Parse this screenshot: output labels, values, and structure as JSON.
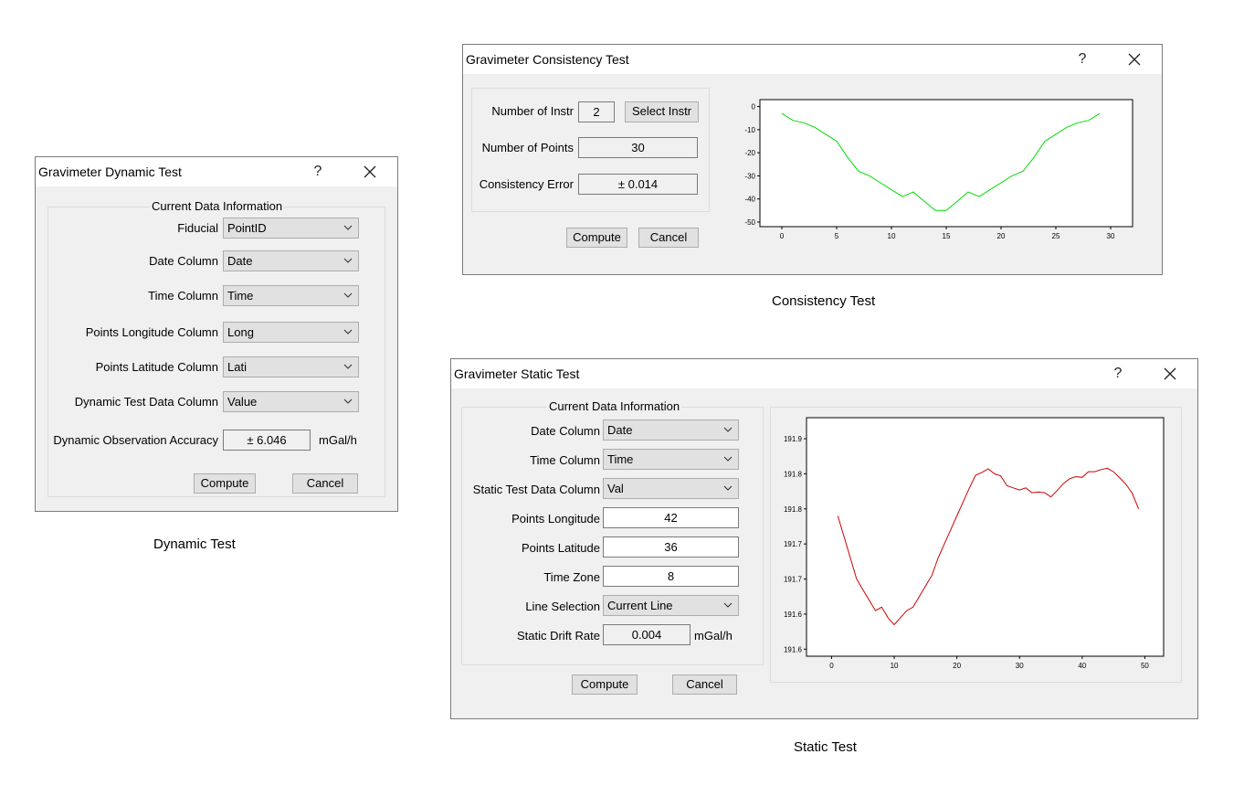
{
  "dynamic": {
    "title": "Gravimeter Dynamic Test",
    "help": "?",
    "group_title": "Current Data Information",
    "fields": [
      {
        "label": "Fiducial",
        "value": "PointID"
      },
      {
        "label": "Date Column",
        "value": "Date"
      },
      {
        "label": "Time Column",
        "value": "Time"
      },
      {
        "label": "Points Longitude Column",
        "value": "Long"
      },
      {
        "label": "Points Latitude Column",
        "value": "Lati"
      },
      {
        "label": "Dynamic Test Data Column",
        "value": "Value"
      }
    ],
    "accuracy_label": "Dynamic Observation Accuracy",
    "accuracy_value": "± 6.046",
    "accuracy_unit": "mGal/h",
    "compute": "Compute",
    "cancel": "Cancel",
    "caption": "Dynamic Test"
  },
  "consistency": {
    "title": "Gravimeter Consistency Test",
    "help": "?",
    "instr_label": "Number of Instr",
    "instr_value": "2",
    "select_instr": "Select Instr",
    "points_label": "Number of Points",
    "points_value": "30",
    "error_label": "Consistency Error",
    "error_value": "± 0.014",
    "compute": "Compute",
    "cancel": "Cancel",
    "caption": "Consistency Test"
  },
  "static": {
    "title": "Gravimeter Static Test",
    "help": "?",
    "group_title": "Current Data Information",
    "combos": [
      {
        "label": "Date Column",
        "value": "Date"
      },
      {
        "label": "Time Column",
        "value": "Time"
      },
      {
        "label": "Static Test Data Column",
        "value": "Val"
      }
    ],
    "inputs": [
      {
        "label": "Points Longitude",
        "value": "42"
      },
      {
        "label": "Points Latitude",
        "value": "36"
      },
      {
        "label": "Time Zone",
        "value": "8"
      }
    ],
    "line_label": "Line Selection",
    "line_value": "Current Line",
    "drift_label": "Static Drift Rate",
    "drift_value": "0.004",
    "drift_unit": "mGal/h",
    "compute": "Compute",
    "cancel": "Cancel",
    "caption": "Static Test"
  },
  "chart_data": [
    {
      "type": "line",
      "xlim": [
        -2,
        32
      ],
      "ylim": [
        -52,
        3
      ],
      "x_ticks": [
        "0",
        "5",
        "10",
        "15",
        "20",
        "25",
        "30"
      ],
      "y_ticks": [
        "0",
        "-10",
        "-20",
        "-30",
        "-40",
        "-50"
      ],
      "series": [
        {
          "color": "#00dd00",
          "x": [
            0,
            1,
            2,
            3,
            4,
            5,
            6,
            7,
            8,
            9,
            10,
            11,
            12,
            13,
            14,
            15,
            16,
            17,
            18,
            19,
            20,
            21,
            22,
            23,
            24,
            25,
            26,
            27,
            28,
            29
          ],
          "y": [
            -3,
            -6,
            -7,
            -9,
            -12,
            -15,
            -22,
            -28,
            -30,
            -33,
            -36,
            -39,
            -37,
            -41,
            -45,
            -45,
            -41,
            -37,
            -39,
            -36,
            -33,
            -30,
            -28,
            -22,
            -15,
            -12,
            -9,
            -7,
            -6,
            -3
          ]
        }
      ]
    },
    {
      "type": "line",
      "xlim": [
        -4,
        53
      ],
      "ylim": [
        191.59,
        191.93
      ],
      "x_ticks": [
        "0",
        "10",
        "20",
        "30",
        "40",
        "50"
      ],
      "y_ticks": [
        "191.9",
        "191.8",
        "191.8",
        "191.7",
        "191.7",
        "191.6",
        "191.6"
      ],
      "series": [
        {
          "color": "#cc0000",
          "x": [
            1,
            2,
            3,
            4,
            5,
            6,
            7,
            8,
            9,
            10,
            11,
            12,
            13,
            14,
            15,
            16,
            17,
            18,
            19,
            20,
            21,
            22,
            23,
            24,
            25,
            26,
            27,
            28,
            29,
            30,
            31,
            32,
            33,
            34,
            35,
            36,
            37,
            38,
            39,
            40,
            41,
            42,
            43,
            44,
            45,
            46,
            47,
            48,
            49
          ],
          "y": [
            191.79,
            191.76,
            191.73,
            191.7,
            191.685,
            191.67,
            191.655,
            191.66,
            191.645,
            191.635,
            191.645,
            191.655,
            191.66,
            191.675,
            191.69,
            191.705,
            191.73,
            191.75,
            191.77,
            191.79,
            191.81,
            191.83,
            191.848,
            191.852,
            191.857,
            191.85,
            191.847,
            191.833,
            191.83,
            191.827,
            191.83,
            191.823,
            191.824,
            191.823,
            191.817,
            191.826,
            191.836,
            191.843,
            191.846,
            191.845,
            191.853,
            191.853,
            191.856,
            191.858,
            191.853,
            191.844,
            191.835,
            191.822,
            191.8
          ]
        }
      ]
    }
  ]
}
